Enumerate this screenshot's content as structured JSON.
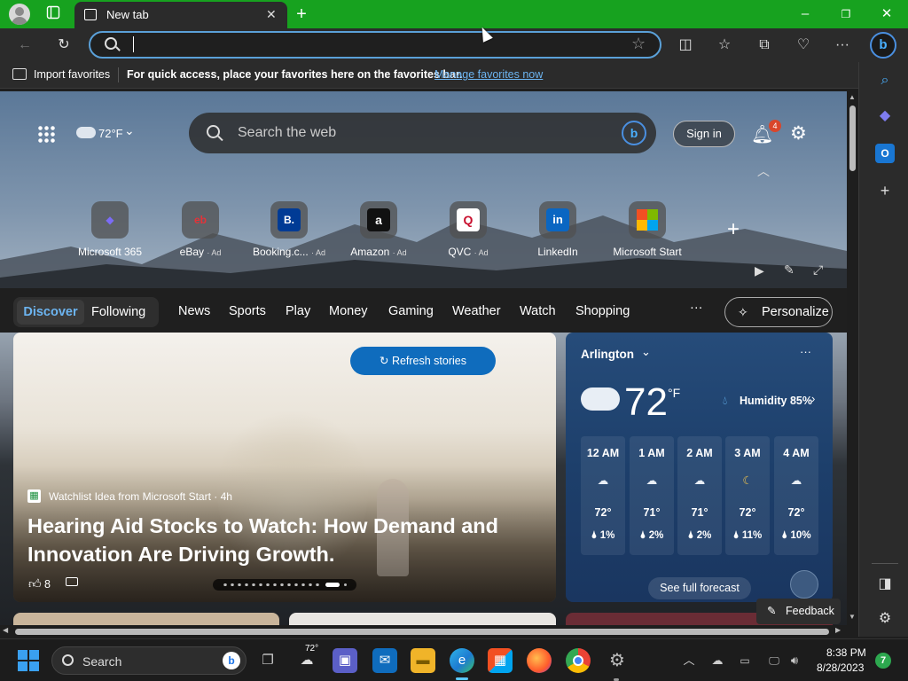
{
  "browser": {
    "tab_title": "New tab",
    "new_tab_symbol": "+",
    "address_value": "",
    "favbar": {
      "import_label": "Import favorites",
      "message": "For quick access, place your favorites here on the favorites bar.",
      "manage_link": "Manage favorites now"
    }
  },
  "newtab": {
    "weather_temp": "72°F",
    "search_placeholder": "Search the web",
    "sign_in": "Sign in",
    "notification_count": "4",
    "quick_links": [
      {
        "label": "Microsoft 365",
        "ad": ""
      },
      {
        "label": "eBay",
        "ad": "· Ad"
      },
      {
        "label": "Booking.c...",
        "ad": "· Ad"
      },
      {
        "label": "Amazon",
        "ad": "· Ad"
      },
      {
        "label": "QVC",
        "ad": "· Ad"
      },
      {
        "label": "LinkedIn",
        "ad": ""
      },
      {
        "label": "Microsoft Start",
        "ad": ""
      }
    ],
    "nav": {
      "discover": "Discover",
      "following": "Following",
      "items": [
        "News",
        "Sports",
        "Play",
        "Money",
        "Gaming",
        "Weather",
        "Watch",
        "Shopping"
      ],
      "more": "···",
      "personalize": "Personalize"
    },
    "story": {
      "refresh": "Refresh stories",
      "source": "Watchlist Idea from Microsoft Start · 4h",
      "headline": "Hearing Aid Stocks to Watch: How Demand and Innovation Are Driving Growth.",
      "likes": "8"
    },
    "weather": {
      "location": "Arlington",
      "temp": "72",
      "unit": "°F",
      "humidity": "Humidity 85%",
      "hours": [
        {
          "time": "12 AM",
          "temp": "72°",
          "precip": "1%"
        },
        {
          "time": "1 AM",
          "temp": "71°",
          "precip": "2%"
        },
        {
          "time": "2 AM",
          "temp": "71°",
          "precip": "2%"
        },
        {
          "time": "3 AM",
          "temp": "72°",
          "precip": "11%"
        },
        {
          "time": "4 AM",
          "temp": "72°",
          "precip": "10%"
        }
      ],
      "forecast_btn": "See full forecast",
      "more": "···"
    },
    "feedback": "Feedback"
  },
  "taskbar": {
    "search": "Search",
    "weather_temp": "72°",
    "time": "8:38 PM",
    "date": "8/28/2023",
    "notification_badge": "7"
  }
}
